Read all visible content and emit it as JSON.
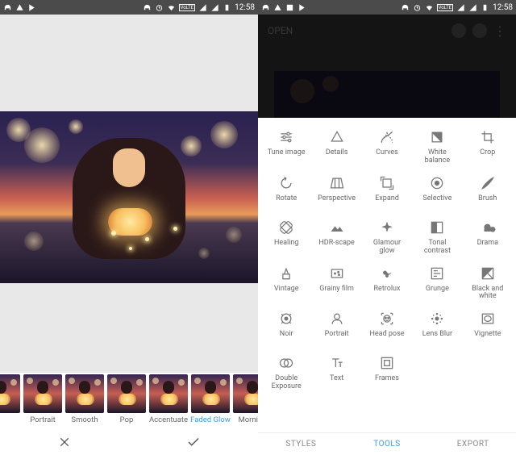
{
  "status": {
    "time": "12:58",
    "volte": "VoLTE"
  },
  "left": {
    "filters": [
      {
        "label": "Portrait"
      },
      {
        "label": "Smooth"
      },
      {
        "label": "Pop"
      },
      {
        "label": "Accentuate"
      },
      {
        "label": "Faded Glow",
        "selected": true
      },
      {
        "label": "Morning"
      }
    ],
    "cancel": "✕",
    "confirm": "✓"
  },
  "right": {
    "open": "OPEN",
    "tools": [
      {
        "name": "tune-image",
        "label": "Tune image"
      },
      {
        "name": "details",
        "label": "Details"
      },
      {
        "name": "curves",
        "label": "Curves"
      },
      {
        "name": "white-balance",
        "label": "White\nbalance"
      },
      {
        "name": "crop",
        "label": "Crop"
      },
      {
        "name": "rotate",
        "label": "Rotate"
      },
      {
        "name": "perspective",
        "label": "Perspective"
      },
      {
        "name": "expand",
        "label": "Expand"
      },
      {
        "name": "selective",
        "label": "Selective"
      },
      {
        "name": "brush",
        "label": "Brush"
      },
      {
        "name": "healing",
        "label": "Healing"
      },
      {
        "name": "hdr-scape",
        "label": "HDR-scape"
      },
      {
        "name": "glamour-glow",
        "label": "Glamour\nglow"
      },
      {
        "name": "tonal-contrast",
        "label": "Tonal\ncontrast"
      },
      {
        "name": "drama",
        "label": "Drama"
      },
      {
        "name": "vintage",
        "label": "Vintage"
      },
      {
        "name": "grainy-film",
        "label": "Grainy film"
      },
      {
        "name": "retrolux",
        "label": "Retrolux"
      },
      {
        "name": "grunge",
        "label": "Grunge"
      },
      {
        "name": "black-and-white",
        "label": "Black and\nwhite"
      },
      {
        "name": "noir",
        "label": "Noir"
      },
      {
        "name": "portrait",
        "label": "Portrait"
      },
      {
        "name": "head-pose",
        "label": "Head pose"
      },
      {
        "name": "lens-blur",
        "label": "Lens Blur"
      },
      {
        "name": "vignette",
        "label": "Vignette"
      },
      {
        "name": "double-exposure",
        "label": "Double\nExposure"
      },
      {
        "name": "text",
        "label": "Text"
      },
      {
        "name": "frames",
        "label": "Frames"
      }
    ],
    "tabs": {
      "styles": "STYLES",
      "tools": "TOOLS",
      "export": "EXPORT"
    }
  }
}
